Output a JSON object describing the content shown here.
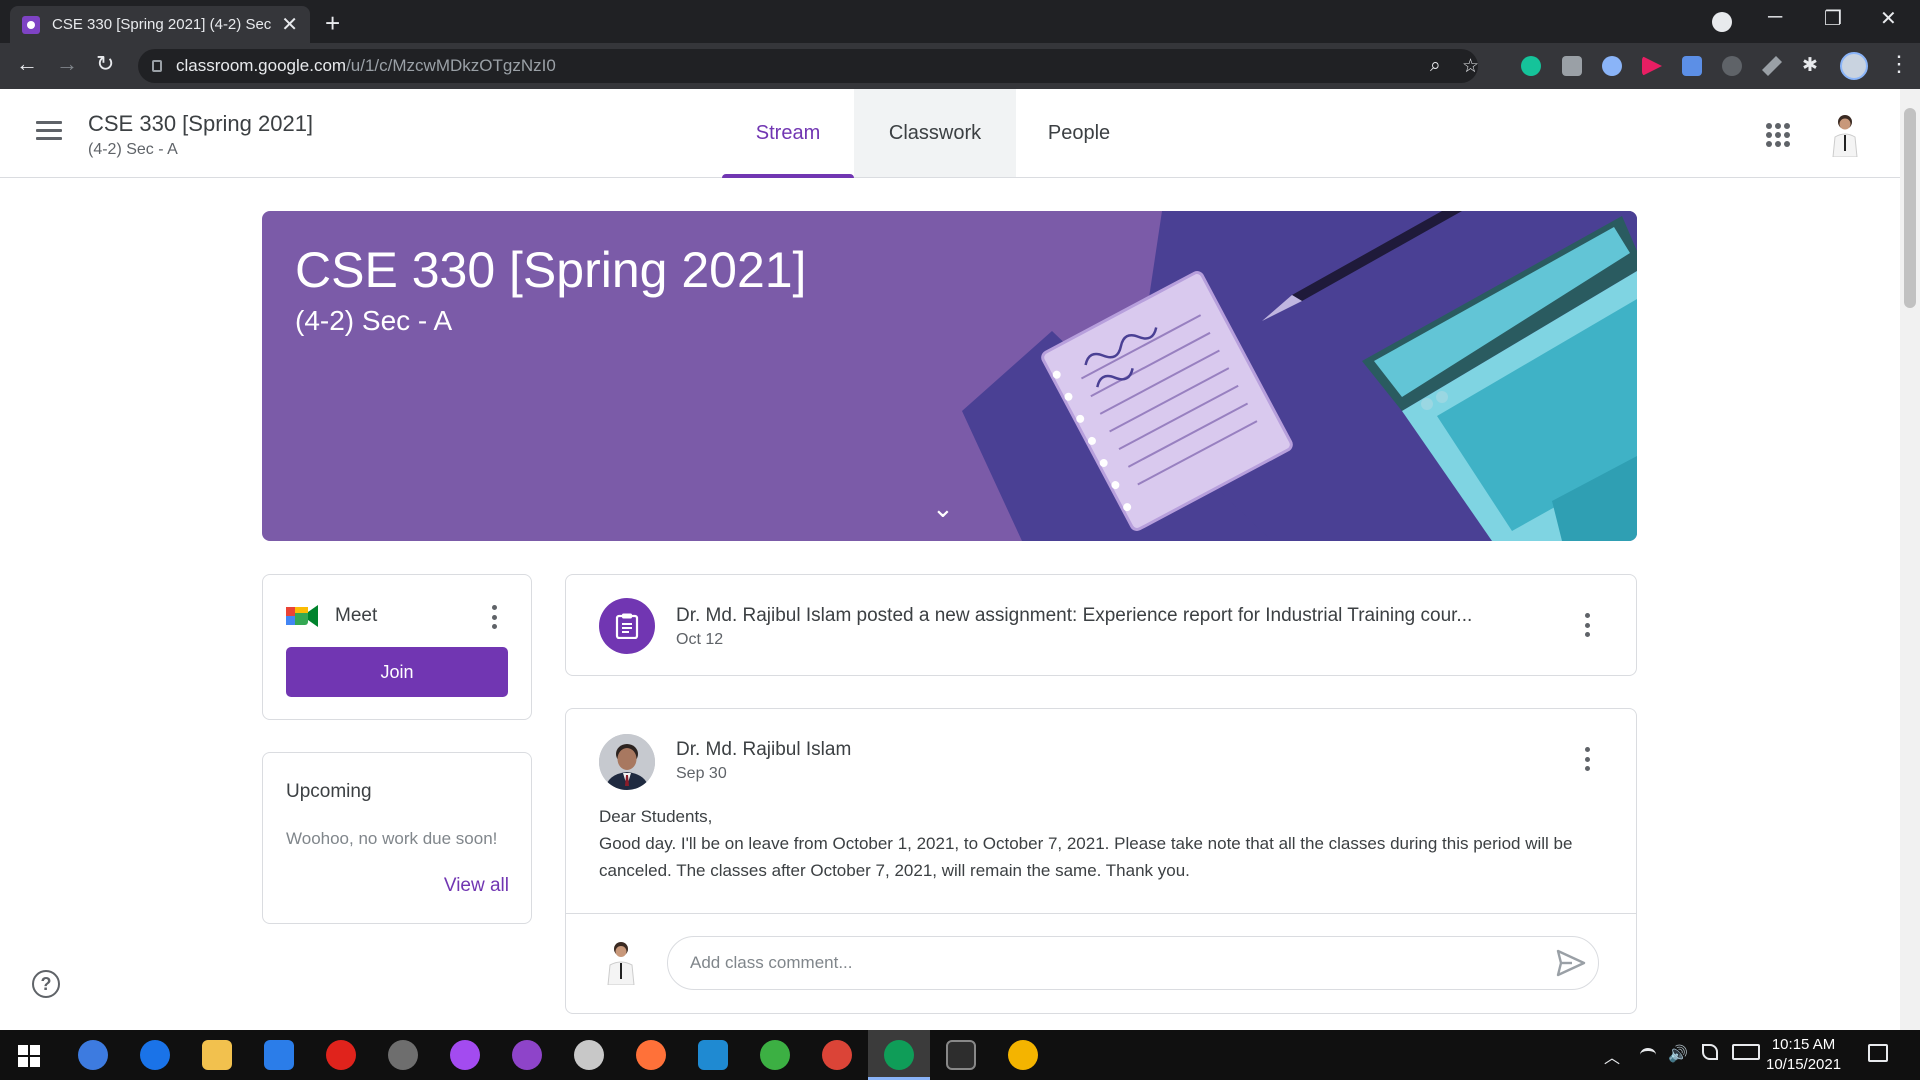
{
  "browser": {
    "tab_title": "CSE 330 [Spring 2021] (4-2) Sec -",
    "tab_close": "✕",
    "new_tab": "+",
    "url_host": "classroom.google.com",
    "url_path": "/u/1/c/MzcwMDkzOTgzNzI0",
    "back": "←",
    "forward": "→",
    "reload": "↻",
    "minimize": "─",
    "restore": "❐",
    "close": "✕",
    "menu": "⋮",
    "zoom_icon": "⌕",
    "star_icon": "☆",
    "extensions_icon": "✱"
  },
  "header": {
    "class_name": "CSE 330 [Spring 2021]",
    "section": "(4-2) Sec - A",
    "tabs": [
      {
        "label": "Stream",
        "active": true
      },
      {
        "label": "Classwork",
        "active": false
      },
      {
        "label": "People",
        "active": false
      }
    ]
  },
  "banner": {
    "title": "CSE 330 [Spring 2021]",
    "subtitle": "(4-2) Sec - A",
    "chevron": "⌄",
    "color": "#7b5ba8"
  },
  "meet": {
    "label": "Meet",
    "join_label": "Join",
    "accent": "#7136b2"
  },
  "upcoming": {
    "title": "Upcoming",
    "empty_text": "Woohoo, no work due soon!",
    "view_all": "View all"
  },
  "help_icon": "?",
  "stream": {
    "assignment": {
      "text": "Dr. Md. Rajibul Islam posted a new assignment: Experience report for Industrial Training cour...",
      "date": "Oct 12"
    },
    "post": {
      "author": "Dr. Md. Rajibul Islam",
      "date": "Sep 30",
      "greeting": "Dear Students,",
      "body": "Good day. I'll be on leave from October 1, 2021, to October 7, 2021. Please take note that all the classes during this period will be canceled. The classes after October 7, 2021, will remain the same. Thank you.",
      "comment_placeholder": "Add class comment..."
    }
  },
  "taskbar": {
    "time": "10:15 AM",
    "date": "10/15/2021",
    "tray_up": "︿",
    "volume": "🔊"
  }
}
